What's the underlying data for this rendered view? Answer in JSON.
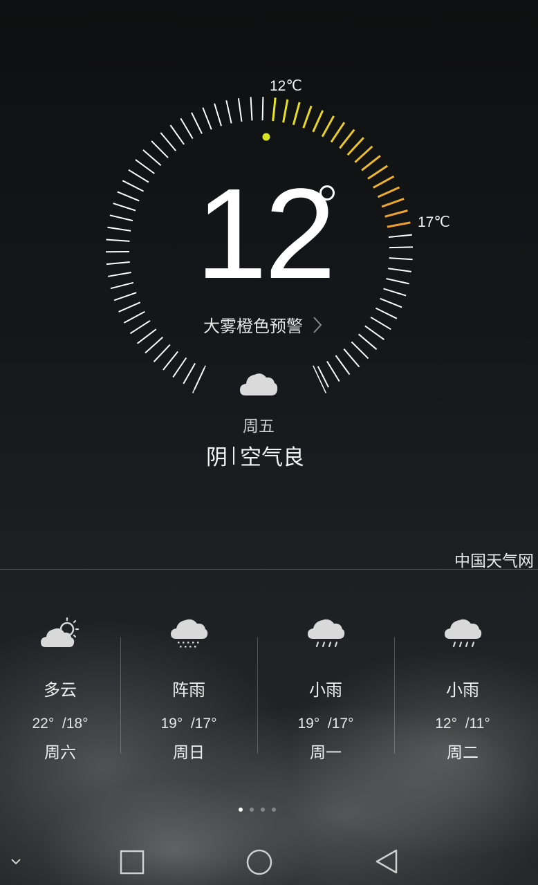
{
  "current": {
    "temperature": "12",
    "min_label": "12℃",
    "max_label": "17℃",
    "warning": "大雾橙色预警",
    "day": "周五",
    "condition": "阴",
    "air_quality": "空气良",
    "icon": "cloudy-icon"
  },
  "source": "中国天气网",
  "forecast": [
    {
      "condition": "多云",
      "high": "22°",
      "low": "/18°",
      "day": "周六",
      "icon": "partly-cloudy-icon"
    },
    {
      "condition": "阵雨",
      "high": "19°",
      "low": "/17°",
      "day": "周日",
      "icon": "shower-icon"
    },
    {
      "condition": "小雨",
      "high": "19°",
      "low": "/17°",
      "day": "周一",
      "icon": "light-rain-icon"
    },
    {
      "condition": "小雨",
      "high": "12°",
      "low": "/11°",
      "day": "周二",
      "icon": "light-rain-icon"
    }
  ],
  "pager": {
    "pages": 4,
    "active": 0
  },
  "navbar": {
    "items": [
      "chevron-down-icon",
      "recent-apps-icon",
      "home-icon",
      "back-icon"
    ]
  },
  "colors": {
    "tick": "#ffffff",
    "arc_start": "#e6ea1f",
    "arc_end": "#f0a030",
    "current_dot": "#d6e51f",
    "icon_fill": "#d9d9d9"
  }
}
